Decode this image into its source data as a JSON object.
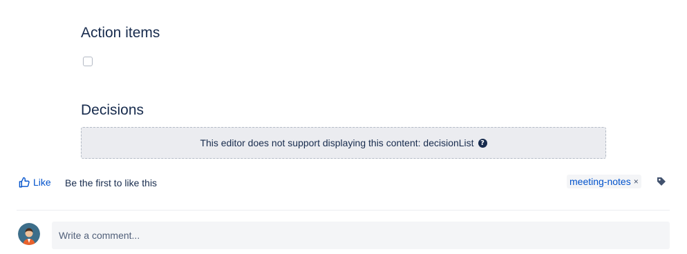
{
  "sections": {
    "action_items_heading": "Action items",
    "decisions_heading": "Decisions"
  },
  "unsupported": {
    "message": "This editor does not support displaying this content: decisionList",
    "help_icon": "?"
  },
  "likes": {
    "like_label": "Like",
    "summary": "Be the first to like this"
  },
  "labels": {
    "items": [
      "meeting-notes"
    ],
    "remove_glyph": "×",
    "tag_icon": "tag-icon"
  },
  "comment": {
    "placeholder": "Write a comment..."
  },
  "colors": {
    "link": "#0052cc",
    "text": "#172b4d",
    "panel_bg": "#ebecf0"
  }
}
